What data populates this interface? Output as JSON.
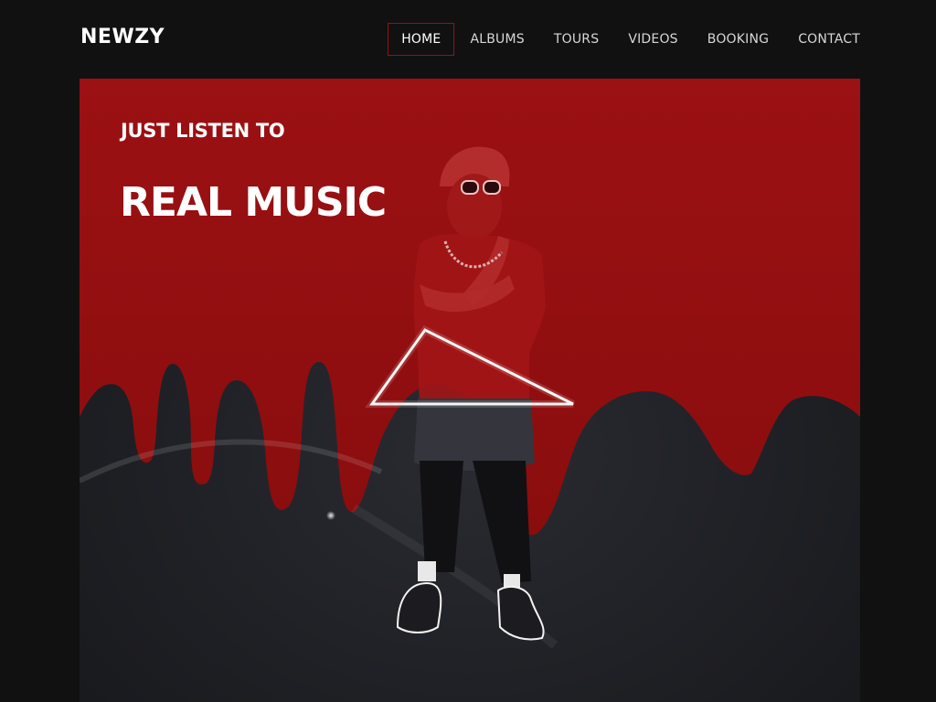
{
  "brand": {
    "logo": "NEWZY"
  },
  "nav": {
    "items": [
      {
        "label": "HOME",
        "active": true
      },
      {
        "label": "ALBUMS",
        "active": false
      },
      {
        "label": "TOURS",
        "active": false
      },
      {
        "label": "VIDEOS",
        "active": false
      },
      {
        "label": "BOOKING",
        "active": false
      },
      {
        "label": "CONTACT",
        "active": false
      }
    ]
  },
  "hero": {
    "kicker": "JUST LISTEN TO",
    "title": "REAL MUSIC"
  },
  "colors": {
    "page_background": "#111112",
    "hero_red": "#9b0f0f",
    "hero_dark": "#1d1e24",
    "text": "#ffffff",
    "nav_text": "#d7d7d7"
  }
}
